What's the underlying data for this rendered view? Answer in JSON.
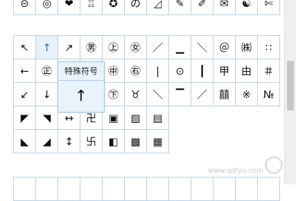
{
  "top_row": [
    "⊝",
    "◎",
    "❤",
    "♖",
    "✪",
    "の",
    "◿",
    "✎",
    "✐",
    "✉",
    "☯",
    "✄"
  ],
  "grid": [
    [
      "↖",
      "↑",
      "↗",
      "㊚",
      "㊤",
      "㊛",
      "／",
      "▁",
      "＼",
      "＠",
      "㈱",
      "∷"
    ],
    [
      "←",
      "㊣",
      "",
      "",
      "㊥",
      "㊨",
      "|",
      "⊙",
      "┃",
      "甲",
      "由",
      "＃"
    ],
    [
      "↙",
      "↓",
      "",
      "",
      "㊦",
      "♉",
      "＼",
      "▔",
      "／",
      "囍",
      "※",
      "№"
    ],
    [
      "◤",
      "◥",
      "↔",
      "卍",
      "▣",
      "▨",
      "▤",
      "",
      "",
      "",
      "",
      ""
    ],
    [
      "◣",
      "◢",
      "↕",
      "卐",
      "◧",
      "▩",
      "▦",
      "",
      "",
      "",
      "",
      ""
    ]
  ],
  "tooltip": {
    "title": "特殊符号",
    "glyph": "↑"
  },
  "watermark": "www.qdfyu.com",
  "colors": {
    "border": "#b8cfe2",
    "highlight_bg": "#e6f1fb",
    "tooltip_bg": "#e8f3fc"
  }
}
